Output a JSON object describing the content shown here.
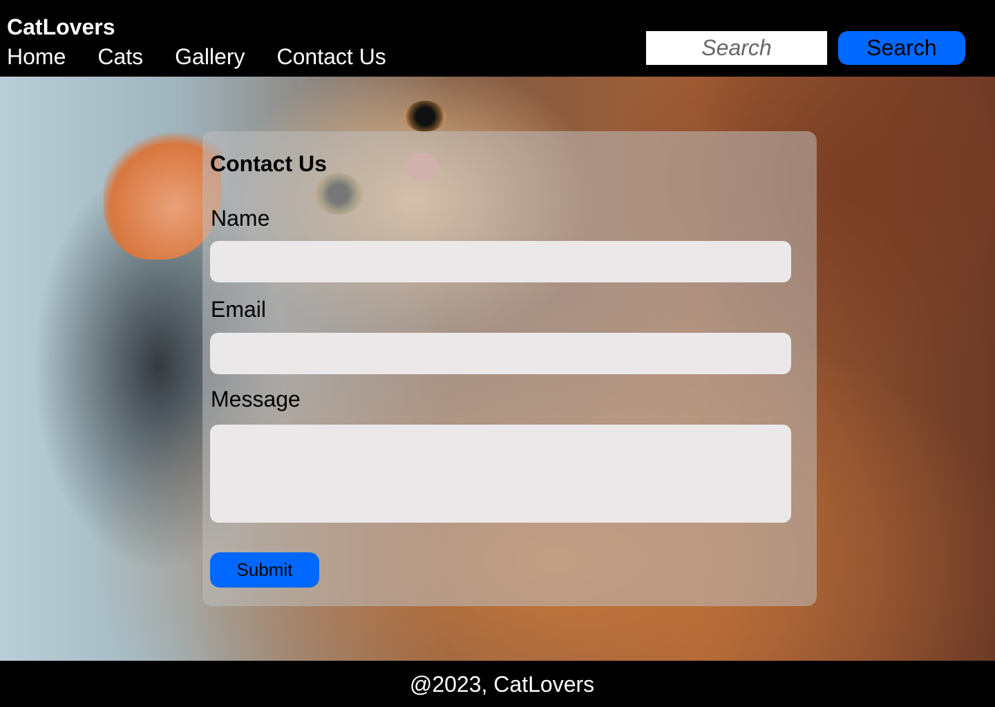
{
  "header": {
    "brand": "CatLovers",
    "nav": [
      "Home",
      "Cats",
      "Gallery",
      "Contact Us"
    ],
    "search_placeholder": "Search",
    "search_button": "Search"
  },
  "contact": {
    "title": "Contact Us",
    "name_label": "Name",
    "email_label": "Email",
    "message_label": "Message",
    "submit_label": "Submit"
  },
  "footer": {
    "text": "@2023, CatLovers"
  },
  "colors": {
    "accent": "#0068ff",
    "header_bg": "#000000",
    "input_bg": "#ebe8e9"
  }
}
